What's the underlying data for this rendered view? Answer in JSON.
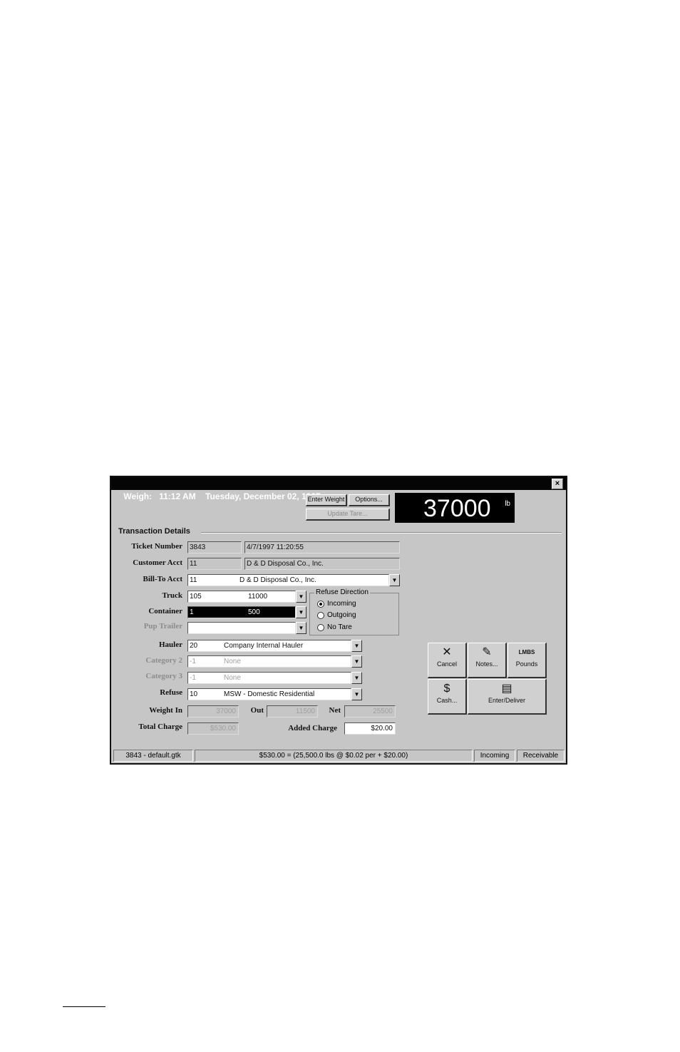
{
  "window": {
    "title": "Weigh:   11:12 AM    Tuesday, December 02, 1997",
    "close_glyph": "×"
  },
  "toolbar": {
    "enter_weight": "Enter Weight",
    "options": "Options...",
    "update_tare": "Update Tare..."
  },
  "scale": {
    "value": "37000",
    "unit": "lb"
  },
  "transaction": {
    "group_title": "Transaction Details",
    "ticket_number": {
      "label": "Ticket Number",
      "value": "3843",
      "date": "4/7/1997 11:20:55"
    },
    "customer_acct": {
      "label": "Customer Acct",
      "value": "11",
      "name": "D & D Disposal Co., Inc."
    },
    "bill_to_acct": {
      "label": "Bill-To Acct",
      "value": "11",
      "name": "D & D Disposal Co., Inc."
    },
    "truck": {
      "label": "Truck",
      "value": "105",
      "tare": "11000"
    },
    "container": {
      "label": "Container",
      "value": "1",
      "tare": "500"
    },
    "pup_trailer": {
      "label": "Pup Trailer",
      "value": ""
    },
    "hauler": {
      "label": "Hauler",
      "value": "20",
      "name": "Company Internal Hauler"
    },
    "category2": {
      "label": "Category 2",
      "value": "-1",
      "name": "None"
    },
    "category3": {
      "label": "Category 3",
      "value": "-1",
      "name": "None"
    },
    "refuse": {
      "label": "Refuse",
      "value": "10",
      "name": "MSW - Domestic Residential"
    },
    "weight_in": {
      "label": "Weight In",
      "value": "37000"
    },
    "out": {
      "label": "Out",
      "value": "11500"
    },
    "net": {
      "label": "Net",
      "value": "25500"
    },
    "total_charge": {
      "label": "Total Charge",
      "value": "$530.00"
    },
    "added_charge": {
      "label": "Added Charge",
      "value": "$20.00"
    }
  },
  "refuse_direction": {
    "title": "Refuse Direction",
    "options": [
      "Incoming",
      "Outgoing",
      "No Tare"
    ],
    "selected": "Incoming"
  },
  "actions": {
    "cancel": "Cancel",
    "notes": "Notes...",
    "pounds": "Pounds",
    "pounds_icon": "LMBS",
    "cash": "Cash...",
    "enter_deliver": "Enter/Deliver"
  },
  "status": {
    "ticket": "3843 - default.gtk",
    "formula": "$530.00 = (25,500.0 lbs @ $0.02 per + $20.00)",
    "direction": "Incoming",
    "payment": "Receivable"
  }
}
